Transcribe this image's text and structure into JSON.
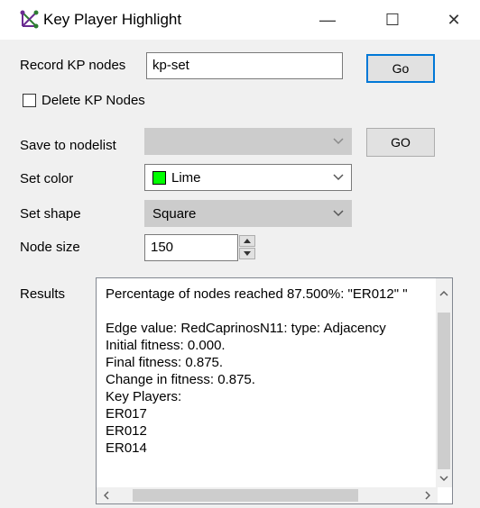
{
  "window": {
    "title": "Key Player Highlight",
    "minimize_glyph": "—",
    "maximize_glyph": "☐",
    "close_glyph": "✕",
    "icon": "network-graph-icon"
  },
  "record": {
    "label": "Record KP nodes",
    "value": "kp-set",
    "button": "Go"
  },
  "delete": {
    "label": "Delete KP Nodes",
    "checked": false
  },
  "save": {
    "label": "Save to nodelist",
    "value": "",
    "button": "GO"
  },
  "color": {
    "label": "Set color",
    "value": "Lime",
    "swatch": "#00ff00"
  },
  "shape": {
    "label": "Set shape",
    "value": "Square"
  },
  "size": {
    "label": "Node size",
    "value": "150"
  },
  "results": {
    "label": "Results",
    "lines": [
      "Percentage of nodes reached 87.500%: \"ER012\" \"",
      "",
      "Edge value: RedCaprinosN11: type: Adjacency",
      "Initial fitness: 0.000.",
      "Final fitness: 0.875.",
      "Change in fitness: 0.875.",
      "Key Players:",
      "ER017",
      "ER012",
      "ER014"
    ]
  },
  "colors": {
    "accent": "#0078d7",
    "disabled_bg": "#cccccc"
  }
}
